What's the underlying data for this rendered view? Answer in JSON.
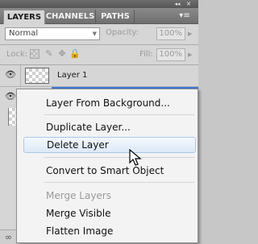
{
  "panel": {
    "tabs": [
      {
        "label": "LAYERS",
        "active": true
      },
      {
        "label": "CHANNELS",
        "active": false
      },
      {
        "label": "PATHS",
        "active": false
      }
    ],
    "menu_icon": "panel-menu-icon",
    "collapse_glyph": "◂◂",
    "close_glyph": "×",
    "menu_glyph": "▾≡"
  },
  "blend": {
    "mode": "Normal"
  },
  "opacity": {
    "label": "Opacity:",
    "value": "100%"
  },
  "lock": {
    "label": "Lock:"
  },
  "fill": {
    "label": "Fill:",
    "value": "100%"
  },
  "layers": [
    {
      "name": "Layer 1",
      "visible": true
    },
    {
      "name": "",
      "visible": true,
      "selected": true
    }
  ],
  "context_menu": {
    "items": [
      {
        "label": "Layer From Background...",
        "enabled": true
      },
      {
        "label": "Duplicate Layer...",
        "enabled": true
      },
      {
        "label": "Delete Layer",
        "enabled": true,
        "hovered": true
      },
      {
        "label": "Convert to Smart Object",
        "enabled": true
      },
      {
        "label": "Merge Layers",
        "enabled": false
      },
      {
        "label": "Merge Visible",
        "enabled": true
      },
      {
        "label": "Flatten Image",
        "enabled": true
      }
    ]
  },
  "colors": {
    "selection": "#3c78d8",
    "menu_hover_border": "#a8c8ec"
  }
}
